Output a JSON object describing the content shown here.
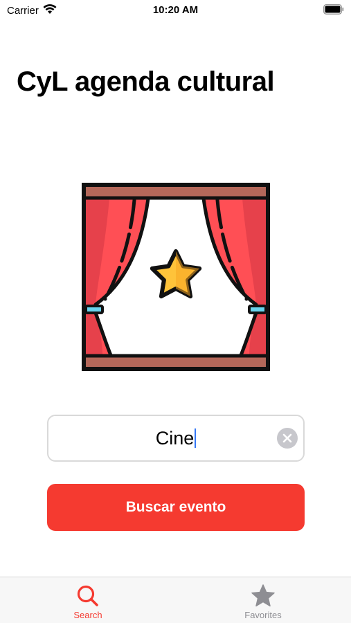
{
  "status_bar": {
    "carrier": "Carrier",
    "time": "10:20 AM"
  },
  "header": {
    "title": "CyL agenda cultural"
  },
  "illustration": {
    "icon": "theater-curtain-star-icon"
  },
  "search": {
    "value": "Cine",
    "clear_icon": "clear-icon"
  },
  "action_button": {
    "label": "Buscar evento",
    "color": "#f53a30"
  },
  "tab_bar": {
    "tabs": [
      {
        "label": "Search",
        "icon": "search-icon",
        "selected": true
      },
      {
        "label": "Favorites",
        "icon": "star-icon",
        "selected": false
      }
    ],
    "active_color": "#f53a30",
    "inactive_color": "#8e8e93"
  }
}
